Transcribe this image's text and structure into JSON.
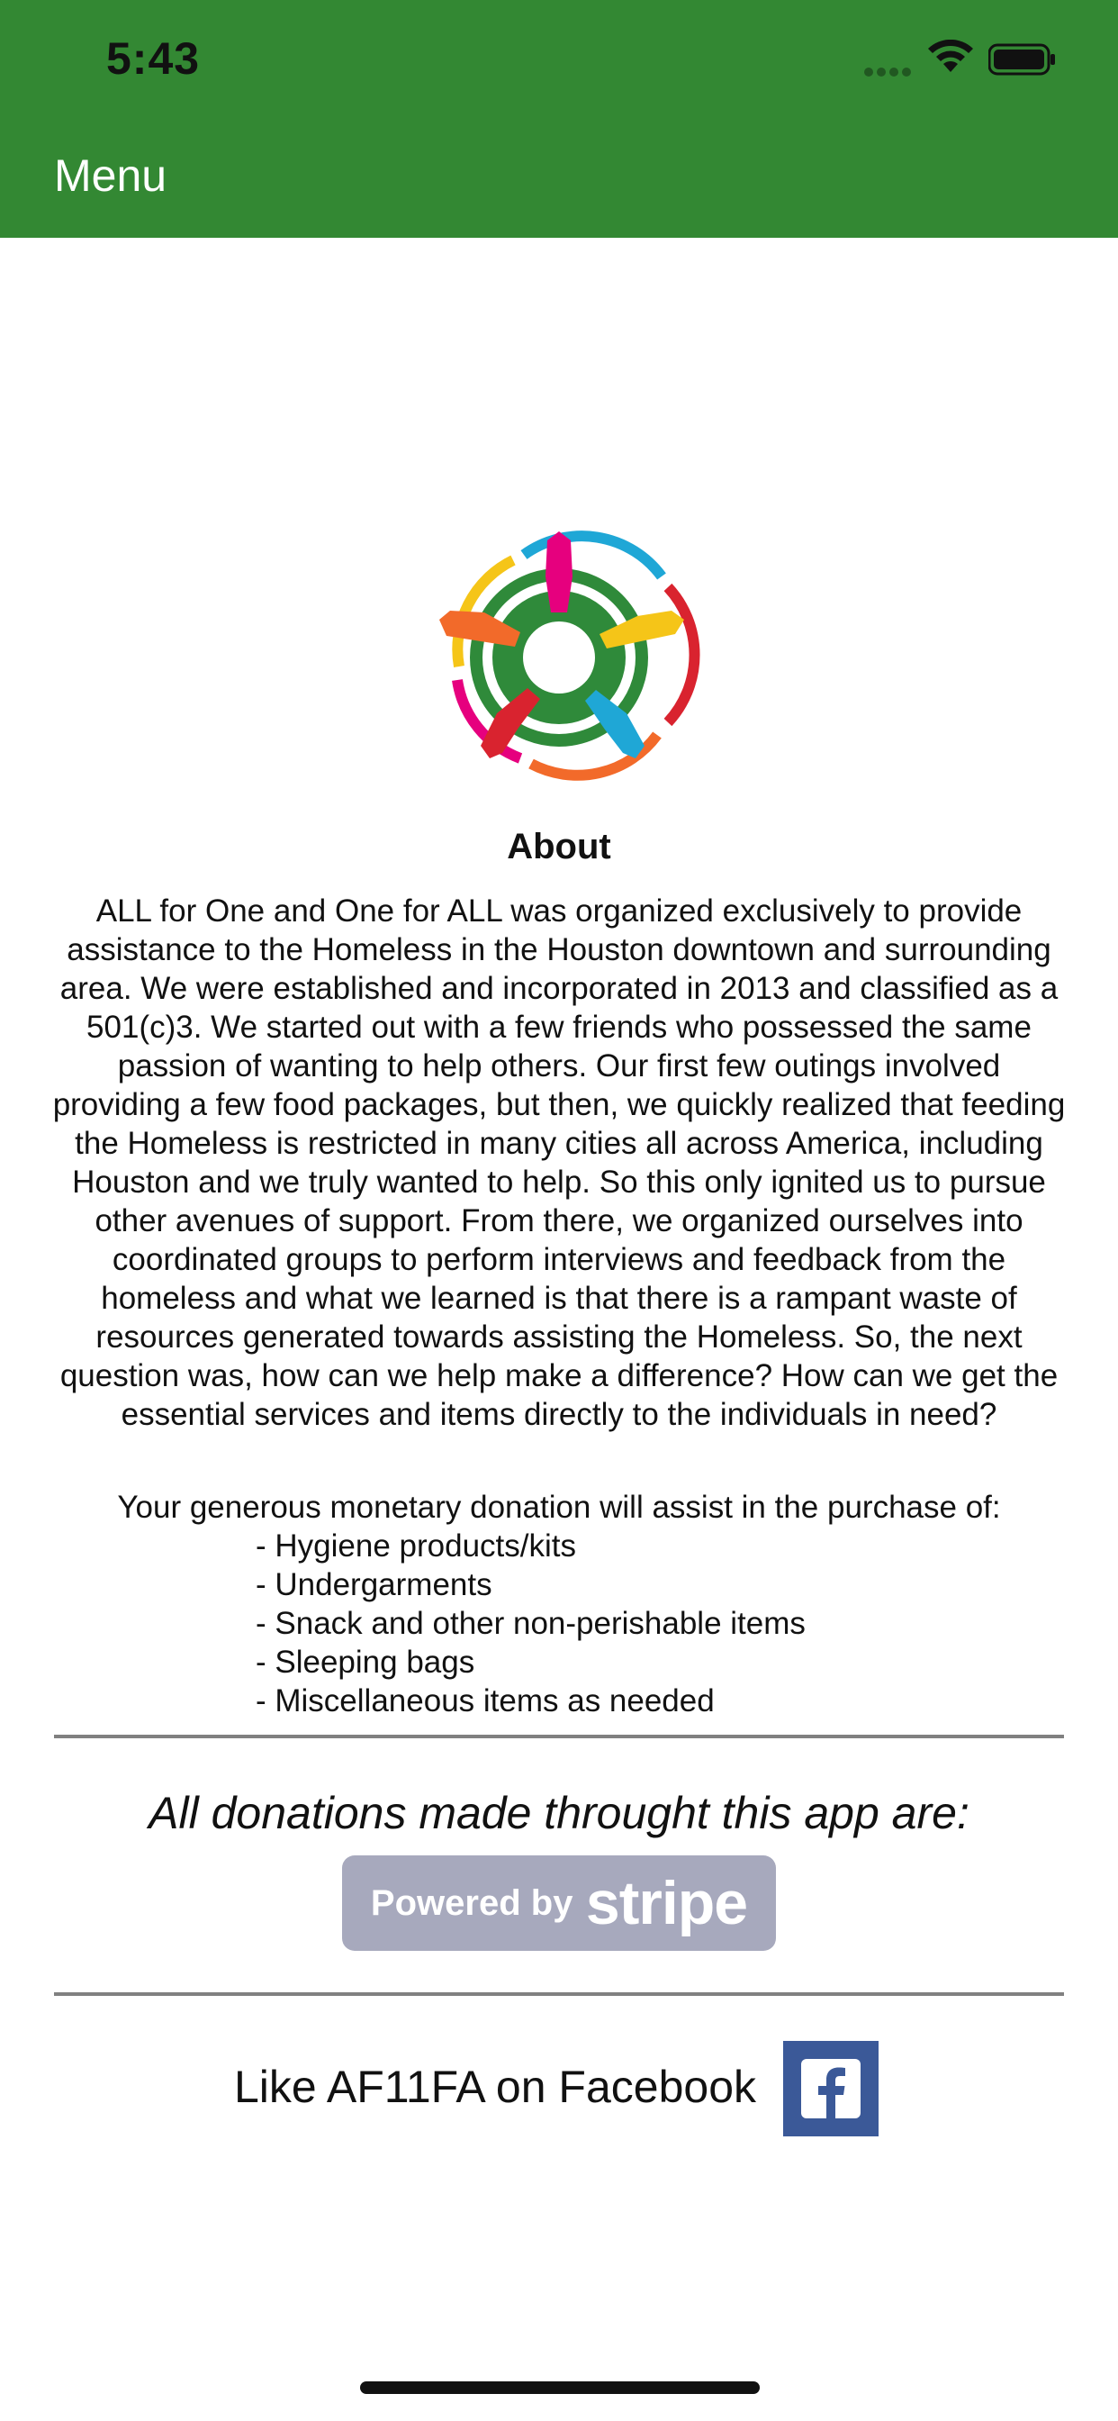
{
  "status_bar": {
    "time": "5:43"
  },
  "header": {
    "menu_label": "Menu",
    "background_color": "#338833"
  },
  "about": {
    "title": "About",
    "body": "ALL for One and One for ALL was organized exclusively to provide assistance to the Homeless in the Houston downtown and surrounding area. We were established and incorporated in 2013 and classified as a 501(c)3. We started out with a few friends who possessed the same passion of wanting to help others. Our first few outings involved providing a few food packages, but then, we quickly realized that feeding the Homeless is restricted in many cities all across America, including Houston  and we truly wanted to help. So this only ignited us to pursue other avenues of support. From there, we organized ourselves into coordinated groups to perform interviews and feedback from the homeless and what we learned is that there is a rampant waste of resources generated towards assisting the Homeless. So, the next question was, how can we help make a difference? How can we get the essential services and items directly to the individuals in need?"
  },
  "donation": {
    "intro": "Your generous monetary donation will assist in the purchase of:",
    "items": [
      "- Hygiene products/kits",
      "- Undergarments",
      "- Snack and other non-perishable items",
      "- Sleeping bags",
      "- Miscellaneous items as needed"
    ]
  },
  "payments": {
    "note": "All donations made throught this app are:",
    "badge_prefix": "Powered by",
    "badge_brand": "stripe"
  },
  "social": {
    "facebook_label": "Like AF11FA on Facebook",
    "facebook_icon": "facebook-icon",
    "facebook_color": "#3b5998"
  },
  "logo": {
    "icon": "hands-globe-logo"
  }
}
